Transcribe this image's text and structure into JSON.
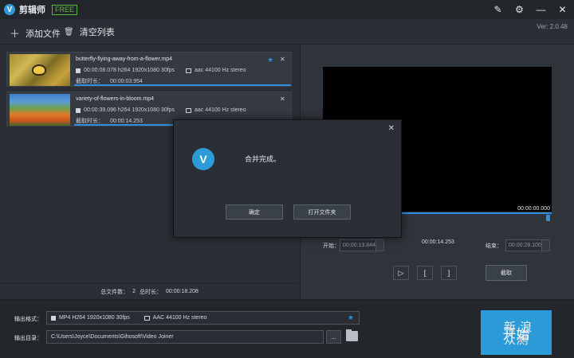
{
  "app": {
    "logo_letter": "V",
    "name": "剪辑师",
    "badge": "FREE",
    "version": "Ver: 2.0.48"
  },
  "window_icons": {
    "edit": "✎",
    "settings": "⚙",
    "minimize": "—",
    "close": "✕"
  },
  "toolbar": {
    "add_icon": "＋",
    "add_label": "添加文件",
    "clear_icon": "🗑",
    "clear_label": "清空列表"
  },
  "files": [
    {
      "name": "butterfly-flying-away-from-a-flower.mp4",
      "video": "00:00:08.078 h264 1920x1080 30fps",
      "audio": "aac 44100 Hz stereo",
      "clip_label": "截取时长：",
      "clip_value": "00:00:03.954",
      "star": "★",
      "close": "✕",
      "progress": 1.0
    },
    {
      "name": "variety-of-flowers-in-bloom.mp4",
      "video": "00:00:39.096 h264 1920x1080 30fps",
      "audio": "aac 44100 Hz stereo",
      "clip_label": "截取时长：",
      "clip_value": "00:00:14.253",
      "star": "",
      "close": "✕",
      "progress": 0.47
    }
  ],
  "summary": {
    "count_label": "总文件数：",
    "count": "2",
    "duration_label": "总时长：",
    "duration": "00:00:18.208"
  },
  "preview": {
    "current_time": "00:00:00.000",
    "start_label": "开始：",
    "start_value": "00:00:13.844",
    "clip_length": "00:00:14.253",
    "end_label": "结束：",
    "end_value": "00:00:28.100",
    "play": "▷",
    "mark_in": "[",
    "mark_out": "]",
    "cut_label": "截取"
  },
  "output": {
    "format_label": "输出格式：",
    "format_video": "MP4 H264 1920x1080 30fps",
    "format_audio": "AAC 44100 Hz stereo",
    "format_star": "★",
    "dir_label": "输出目录：",
    "dir_value": "C:\\Users\\Joyce\\Documents\\Gihosoft\\Video Joiner",
    "browse": "...",
    "start_button": "开始"
  },
  "dialog": {
    "close": "✕",
    "logo_letter": "V",
    "message": "合并完成。",
    "ok_label": "确定",
    "open_folder_label": "打开文件夹"
  },
  "watermark": {
    "line1": "新 浪",
    "line2": "众测"
  }
}
